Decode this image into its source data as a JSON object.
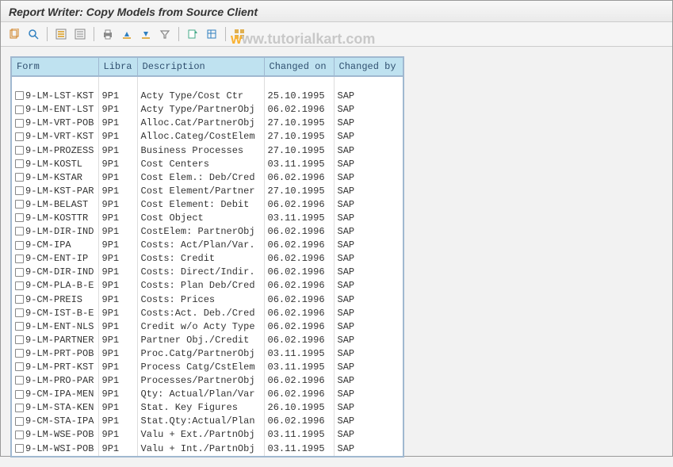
{
  "title": "Report Writer: Copy Models from Source Client",
  "watermark": "www.tutorialkart.com",
  "columns": {
    "form": "Form",
    "library": "Libra",
    "description": "Description",
    "changed_on": "Changed on",
    "changed_by": "Changed by"
  },
  "rows": [
    {
      "form": "9-LM-LST-KST",
      "lib": "9P1",
      "desc": "Acty Type/Cost Ctr",
      "chg": "25.10.1995",
      "by": "SAP"
    },
    {
      "form": "9-LM-ENT-LST",
      "lib": "9P1",
      "desc": "Acty Type/PartnerObj",
      "chg": "06.02.1996",
      "by": "SAP"
    },
    {
      "form": "9-LM-VRT-POB",
      "lib": "9P1",
      "desc": "Alloc.Cat/PartnerObj",
      "chg": "27.10.1995",
      "by": "SAP"
    },
    {
      "form": "9-LM-VRT-KST",
      "lib": "9P1",
      "desc": "Alloc.Categ/CostElem",
      "chg": "27.10.1995",
      "by": "SAP"
    },
    {
      "form": "9-LM-PROZESS",
      "lib": "9P1",
      "desc": "Business Processes",
      "chg": "27.10.1995",
      "by": "SAP"
    },
    {
      "form": "9-LM-KOSTL",
      "lib": "9P1",
      "desc": "Cost Centers",
      "chg": "03.11.1995",
      "by": "SAP"
    },
    {
      "form": "9-LM-KSTAR",
      "lib": "9P1",
      "desc": "Cost Elem.: Deb/Cred",
      "chg": "06.02.1996",
      "by": "SAP"
    },
    {
      "form": "9-LM-KST-PAR",
      "lib": "9P1",
      "desc": "Cost Element/Partner",
      "chg": "27.10.1995",
      "by": "SAP"
    },
    {
      "form": "9-LM-BELAST",
      "lib": "9P1",
      "desc": "Cost Element: Debit",
      "chg": "06.02.1996",
      "by": "SAP"
    },
    {
      "form": "9-LM-KOSTTR",
      "lib": "9P1",
      "desc": "Cost Object",
      "chg": "03.11.1995",
      "by": "SAP"
    },
    {
      "form": "9-LM-DIR-IND",
      "lib": "9P1",
      "desc": "CostElem: PartnerObj",
      "chg": "06.02.1996",
      "by": "SAP"
    },
    {
      "form": "9-CM-IPA",
      "lib": "9P1",
      "desc": "Costs: Act/Plan/Var.",
      "chg": "06.02.1996",
      "by": "SAP"
    },
    {
      "form": "9-CM-ENT-IP",
      "lib": "9P1",
      "desc": "Costs: Credit",
      "chg": "06.02.1996",
      "by": "SAP"
    },
    {
      "form": "9-CM-DIR-IND",
      "lib": "9P1",
      "desc": "Costs: Direct/Indir.",
      "chg": "06.02.1996",
      "by": "SAP"
    },
    {
      "form": "9-CM-PLA-B-E",
      "lib": "9P1",
      "desc": "Costs: Plan Deb/Cred",
      "chg": "06.02.1996",
      "by": "SAP"
    },
    {
      "form": "9-CM-PREIS",
      "lib": "9P1",
      "desc": "Costs: Prices",
      "chg": "06.02.1996",
      "by": "SAP"
    },
    {
      "form": "9-CM-IST-B-E",
      "lib": "9P1",
      "desc": "Costs:Act. Deb./Cred",
      "chg": "06.02.1996",
      "by": "SAP"
    },
    {
      "form": "9-LM-ENT-NLS",
      "lib": "9P1",
      "desc": "Credit w/o Acty Type",
      "chg": "06.02.1996",
      "by": "SAP"
    },
    {
      "form": "9-LM-PARTNER",
      "lib": "9P1",
      "desc": "Partner Obj./Credit",
      "chg": "06.02.1996",
      "by": "SAP"
    },
    {
      "form": "9-LM-PRT-POB",
      "lib": "9P1",
      "desc": "Proc.Catg/PartnerObj",
      "chg": "03.11.1995",
      "by": "SAP"
    },
    {
      "form": "9-LM-PRT-KST",
      "lib": "9P1",
      "desc": "Process Catg/CstElem",
      "chg": "03.11.1995",
      "by": "SAP"
    },
    {
      "form": "9-LM-PRO-PAR",
      "lib": "9P1",
      "desc": "Processes/PartnerObj",
      "chg": "06.02.1996",
      "by": "SAP"
    },
    {
      "form": "9-CM-IPA-MEN",
      "lib": "9P1",
      "desc": "Qty: Actual/Plan/Var",
      "chg": "06.02.1996",
      "by": "SAP"
    },
    {
      "form": "9-LM-STA-KEN",
      "lib": "9P1",
      "desc": "Stat. Key Figures",
      "chg": "26.10.1995",
      "by": "SAP"
    },
    {
      "form": "9-CM-STA-IPA",
      "lib": "9P1",
      "desc": "Stat.Qty:Actual/Plan",
      "chg": "06.02.1996",
      "by": "SAP"
    },
    {
      "form": "9-LM-WSE-POB",
      "lib": "9P1",
      "desc": "Valu + Ext./PartnObj",
      "chg": "03.11.1995",
      "by": "SAP"
    },
    {
      "form": "9-LM-WSI-POB",
      "lib": "9P1",
      "desc": "Valu + Int./PartnObj",
      "chg": "03.11.1995",
      "by": "SAP"
    }
  ]
}
